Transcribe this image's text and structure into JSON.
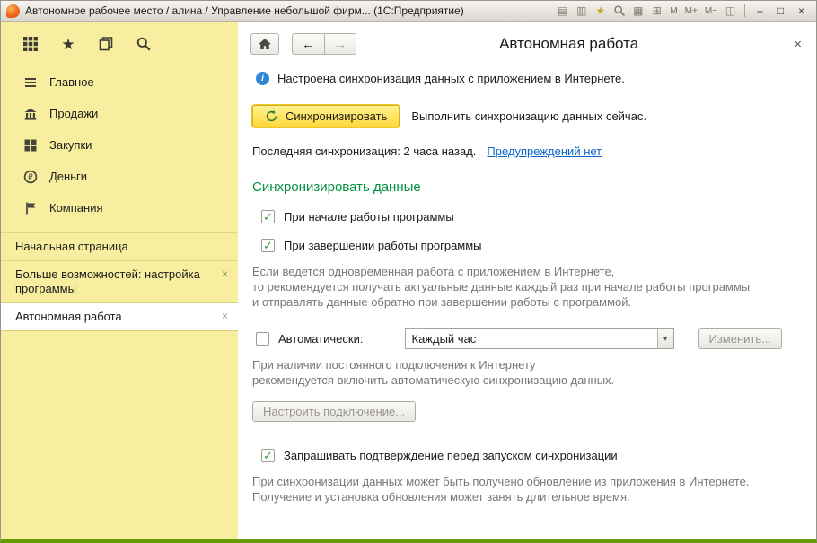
{
  "titlebar": {
    "title": "Автономное рабочее место / алина / Управление небольшой фирм...  (1С:Предприятие)",
    "tb_icons": {
      "documents": "▤",
      "print": "▥",
      "favorites": "★",
      "calendar": "▦",
      "calculator": "⊞",
      "panels": "◫"
    },
    "memory": [
      "M",
      "M+",
      "M−"
    ],
    "window_controls": {
      "minimize": "–",
      "maximize": "□",
      "close": "×"
    }
  },
  "icons": {
    "back": "←",
    "forward": "→",
    "info": "i",
    "check": "✓",
    "dropdown": "▾",
    "close": "×"
  },
  "sidebar": {
    "menu": [
      {
        "label": "Главное"
      },
      {
        "label": "Продажи"
      },
      {
        "label": "Закупки"
      },
      {
        "label": "Деньги"
      },
      {
        "label": "Компания"
      }
    ],
    "tabs": [
      {
        "label": "Начальная страница"
      },
      {
        "label": "Больше возможностей: настройка программы"
      },
      {
        "label": "Автономная работа"
      }
    ]
  },
  "main": {
    "title": "Автономная работа",
    "info_text": "Настроена синхронизация данных с приложением в Интернете.",
    "sync_button_label": "Синхронизировать",
    "sync_hint": "Выполнить синхронизацию данных сейчас.",
    "last_sync_text": "Последняя синхронизация: 2 часа назад.",
    "warnings_link": "Предупреждений нет",
    "section_heading": "Синхронизировать данные",
    "checkbox_start": "При начале работы программы",
    "checkbox_finish": "При завершении работы программы",
    "para_simultaneous": "Если ведется одновременная работа с приложением в Интернете,\nто рекомендуется получать актуальные данные каждый раз при начале работы программы\nи отправлять данные обратно при завершении работы с программой.",
    "checkbox_auto": "Автоматически:",
    "combo_value": "Каждый час",
    "change_button": "Изменить...",
    "para_auto": "При наличии постоянного подключения к Интернету\nрекомендуется включить автоматическую синхронизацию данных.",
    "configure_button": "Настроить подключение...",
    "checkbox_confirm": "Запрашивать подтверждение перед запуском синхронизации",
    "para_update": "При синхронизации данных может быть получено обновление из приложения в Интернете.\nПолучение и установка обновления может занять длительное время."
  }
}
